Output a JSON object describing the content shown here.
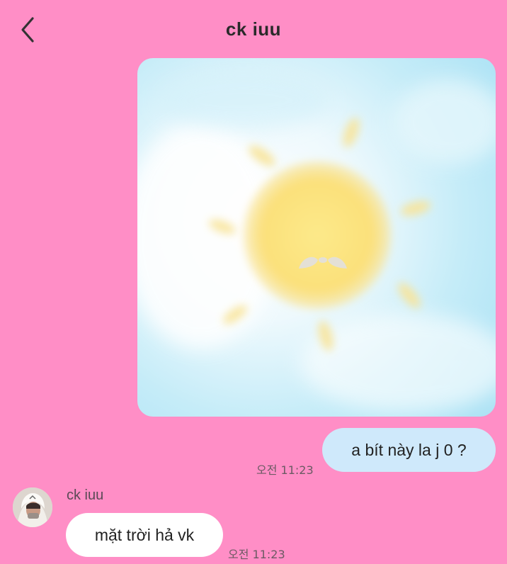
{
  "colors": {
    "background": "#ff8ec6",
    "outgoing_bubble": "#cfe9fb",
    "incoming_bubble": "#ffffff",
    "sun": "#fbe17a",
    "sky": "#bfe8f7"
  },
  "header": {
    "back_icon": "chevron-left-icon",
    "title": "ck iuu"
  },
  "messages": {
    "outgoing_image": {
      "icon": "sun-drawing-image"
    },
    "outgoing_text": {
      "text": "a bít này la j 0 ?",
      "time": "오전 11:23"
    },
    "incoming": {
      "sender": "ck iuu",
      "text": "mặt trời hả vk",
      "time": "오전 11:23"
    }
  }
}
